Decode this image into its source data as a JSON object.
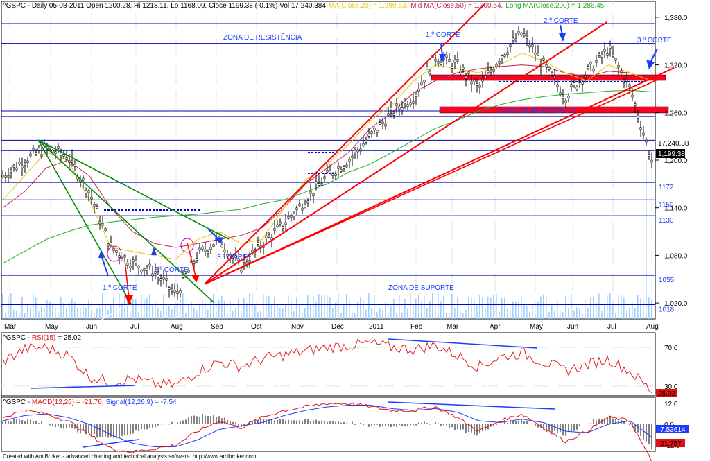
{
  "header": {
    "price": "^GSPC - Daily 05-08-2011 Open 1200.28, Hi 1218.11, Lo 1168.09, Close 1199.38 (-0.1%) Vol 17,240,384",
    "ma20": "MA(Close,20) = 1,299.53,",
    "ma50": "Mid MA(Close,50) = 1,300.54,",
    "ma200": "Long MA(Close,200) = 1,286.45"
  },
  "rsi_header": {
    "prefix": "^GSPC - ",
    "name": "RSI(15)",
    "value": "= 25.02"
  },
  "macd_header": {
    "prefix": "^GSPC - ",
    "name": "MACD(12,26) = -21.76,",
    "signal": "Signal(12,26,9) = -7.54"
  },
  "footer": "Created with AmiBroker - advanced charting and technical analysis software. http://www.amibroker.com",
  "colors": {
    "price": "#000000",
    "ma20": "#e6c800",
    "ma50": "#c81e50",
    "ma200": "#21b021",
    "trend_red": "#ff0000",
    "trend_green": "#008c00",
    "level_blue": "#0000c8",
    "rsi": "#e01010",
    "macd": "#e01010",
    "signal": "#1a3cff",
    "volume": "#9fd0ff"
  },
  "annotations": {
    "zona_resistencia_top": "ZONA DE RESISTÊNCIA",
    "zona_resistencia_mid": "ZONA DE RESISTÊNCIA",
    "zona_suporte": "ZONA DE SUPORTE",
    "corte1_left": "1.º CORTE",
    "corte2_left": "2.º CORTE",
    "corte3_left": "3.º CORTE",
    "corte1_right": "1.º CORTE",
    "corte2_right": "2.º CORTE",
    "corte3_right": "3.º CORTE"
  },
  "badges": {
    "volume": "17,240.38",
    "close": "1,199.38",
    "rsi": "25.02",
    "signal": "-7.53614",
    "macd": "-21.757"
  },
  "chart_data": [
    {
      "type": "line",
      "title": "^GSPC - Daily 05-08-2011",
      "x": [
        "Mar",
        "May",
        "Jun",
        "Jul",
        "Aug",
        "Sep",
        "Oct",
        "Nov",
        "Dec",
        "2011",
        "Feb",
        "Mar",
        "Apr",
        "May",
        "Jun",
        "Jul",
        "Aug"
      ],
      "ylim": [
        1000,
        1400
      ],
      "y_ticks": [
        "1,380.0",
        "1,320.0",
        "1,260.0",
        "1,200.0",
        "1,140.0",
        "1,080.0",
        "1,020.0"
      ],
      "level_labels": [
        "1172",
        "1150",
        "1130",
        "1055",
        "1018"
      ],
      "series": [
        {
          "name": "MA(Close,20)",
          "values": [
            1150,
            1180,
            1210,
            1200,
            1150,
            1090,
            1085,
            1080,
            1075,
            1100,
            1110,
            1095,
            1100,
            1140,
            1175,
            1195,
            1220,
            1250,
            1270,
            1300,
            1320,
            1315,
            1310,
            1320,
            1335,
            1325,
            1310,
            1300,
            1320,
            1310,
            1300
          ]
        },
        {
          "name": "Mid MA(Close,50)",
          "values": [
            1140,
            1160,
            1190,
            1200,
            1180,
            1140,
            1110,
            1095,
            1090,
            1095,
            1100,
            1105,
            1115,
            1140,
            1170,
            1190,
            1210,
            1240,
            1260,
            1285,
            1300,
            1310,
            1315,
            1318,
            1320,
            1318,
            1310,
            1305,
            1312,
            1310,
            1300
          ]
        },
        {
          "name": "Long MA(Close,200)",
          "values": [
            1070,
            1085,
            1100,
            1110,
            1118,
            1122,
            1125,
            1128,
            1130,
            1132,
            1135,
            1138,
            1145,
            1150,
            1160,
            1170,
            1185,
            1195,
            1210,
            1225,
            1240,
            1250,
            1262,
            1270,
            1276,
            1280,
            1283,
            1285,
            1287,
            1288,
            1286
          ]
        },
        {
          "name": "Close",
          "values": [
            1180,
            1200,
            1215,
            1205,
            1160,
            1090,
            1070,
            1060,
            1030,
            1080,
            1100,
            1065,
            1095,
            1120,
            1150,
            1180,
            1200,
            1230,
            1260,
            1280,
            1330,
            1320,
            1290,
            1330,
            1360,
            1320,
            1280,
            1310,
            1340,
            1290,
            1199
          ]
        }
      ],
      "volume_last": 17240384
    },
    {
      "type": "line",
      "title": "RSI(15)",
      "ylim": [
        20,
        85
      ],
      "y_ticks": [
        "70.0",
        "30.0"
      ],
      "series": [
        {
          "name": "RSI(15)",
          "values": [
            55,
            68,
            70,
            62,
            40,
            34,
            38,
            32,
            31,
            45,
            55,
            50,
            58,
            62,
            66,
            70,
            72,
            74,
            70,
            68,
            72,
            62,
            50,
            60,
            64,
            55,
            46,
            52,
            58,
            45,
            25
          ]
        }
      ]
    },
    {
      "type": "line",
      "title": "MACD(12,26)",
      "ylim": [
        -24,
        16
      ],
      "y_ticks": [
        "12.0",
        "0.0",
        "-12.0"
      ],
      "series": [
        {
          "name": "MACD(12,26)",
          "values": [
            4,
            8,
            6,
            2,
            -6,
            -14,
            -16,
            -14,
            -12,
            -4,
            2,
            -2,
            4,
            8,
            10,
            12,
            12,
            10,
            8,
            8,
            10,
            4,
            -4,
            2,
            6,
            -2,
            -10,
            -4,
            4,
            2,
            -21.76
          ]
        },
        {
          "name": "Signal(12,26,9)",
          "values": [
            2,
            5,
            6,
            4,
            0,
            -6,
            -11,
            -13,
            -13,
            -9,
            -3,
            -1,
            1,
            5,
            8,
            10,
            11,
            11,
            9,
            8,
            9,
            7,
            2,
            1,
            3,
            1,
            -4,
            -5,
            0,
            2,
            -7.54
          ]
        }
      ]
    }
  ]
}
